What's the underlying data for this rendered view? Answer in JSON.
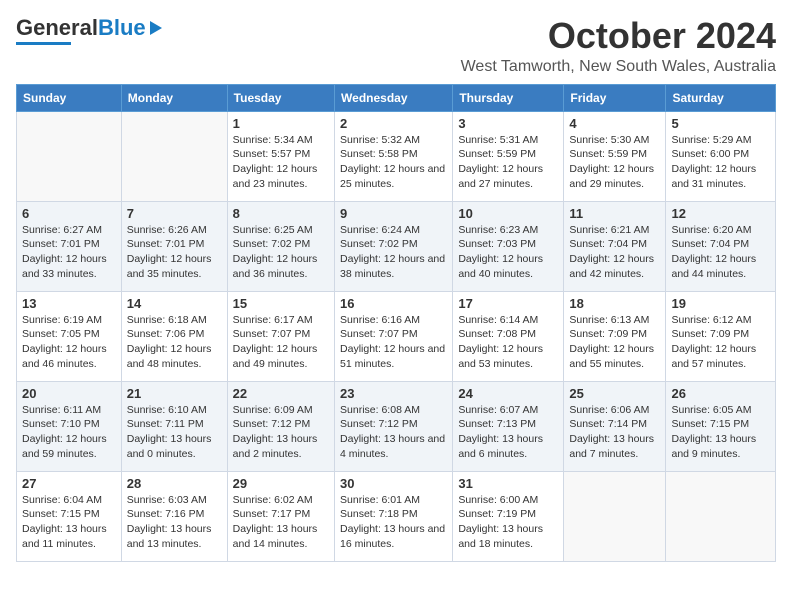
{
  "logo": {
    "line1": "General",
    "line2": "Blue"
  },
  "title": "October 2024",
  "subtitle": "West Tamworth, New South Wales, Australia",
  "days_of_week": [
    "Sunday",
    "Monday",
    "Tuesday",
    "Wednesday",
    "Thursday",
    "Friday",
    "Saturday"
  ],
  "weeks": [
    [
      {
        "day": "",
        "content": ""
      },
      {
        "day": "",
        "content": ""
      },
      {
        "day": "1",
        "content": "Sunrise: 5:34 AM\nSunset: 5:57 PM\nDaylight: 12 hours and 23 minutes."
      },
      {
        "day": "2",
        "content": "Sunrise: 5:32 AM\nSunset: 5:58 PM\nDaylight: 12 hours and 25 minutes."
      },
      {
        "day": "3",
        "content": "Sunrise: 5:31 AM\nSunset: 5:59 PM\nDaylight: 12 hours and 27 minutes."
      },
      {
        "day": "4",
        "content": "Sunrise: 5:30 AM\nSunset: 5:59 PM\nDaylight: 12 hours and 29 minutes."
      },
      {
        "day": "5",
        "content": "Sunrise: 5:29 AM\nSunset: 6:00 PM\nDaylight: 12 hours and 31 minutes."
      }
    ],
    [
      {
        "day": "6",
        "content": "Sunrise: 6:27 AM\nSunset: 7:01 PM\nDaylight: 12 hours and 33 minutes."
      },
      {
        "day": "7",
        "content": "Sunrise: 6:26 AM\nSunset: 7:01 PM\nDaylight: 12 hours and 35 minutes."
      },
      {
        "day": "8",
        "content": "Sunrise: 6:25 AM\nSunset: 7:02 PM\nDaylight: 12 hours and 36 minutes."
      },
      {
        "day": "9",
        "content": "Sunrise: 6:24 AM\nSunset: 7:02 PM\nDaylight: 12 hours and 38 minutes."
      },
      {
        "day": "10",
        "content": "Sunrise: 6:23 AM\nSunset: 7:03 PM\nDaylight: 12 hours and 40 minutes."
      },
      {
        "day": "11",
        "content": "Sunrise: 6:21 AM\nSunset: 7:04 PM\nDaylight: 12 hours and 42 minutes."
      },
      {
        "day": "12",
        "content": "Sunrise: 6:20 AM\nSunset: 7:04 PM\nDaylight: 12 hours and 44 minutes."
      }
    ],
    [
      {
        "day": "13",
        "content": "Sunrise: 6:19 AM\nSunset: 7:05 PM\nDaylight: 12 hours and 46 minutes."
      },
      {
        "day": "14",
        "content": "Sunrise: 6:18 AM\nSunset: 7:06 PM\nDaylight: 12 hours and 48 minutes."
      },
      {
        "day": "15",
        "content": "Sunrise: 6:17 AM\nSunset: 7:07 PM\nDaylight: 12 hours and 49 minutes."
      },
      {
        "day": "16",
        "content": "Sunrise: 6:16 AM\nSunset: 7:07 PM\nDaylight: 12 hours and 51 minutes."
      },
      {
        "day": "17",
        "content": "Sunrise: 6:14 AM\nSunset: 7:08 PM\nDaylight: 12 hours and 53 minutes."
      },
      {
        "day": "18",
        "content": "Sunrise: 6:13 AM\nSunset: 7:09 PM\nDaylight: 12 hours and 55 minutes."
      },
      {
        "day": "19",
        "content": "Sunrise: 6:12 AM\nSunset: 7:09 PM\nDaylight: 12 hours and 57 minutes."
      }
    ],
    [
      {
        "day": "20",
        "content": "Sunrise: 6:11 AM\nSunset: 7:10 PM\nDaylight: 12 hours and 59 minutes."
      },
      {
        "day": "21",
        "content": "Sunrise: 6:10 AM\nSunset: 7:11 PM\nDaylight: 13 hours and 0 minutes."
      },
      {
        "day": "22",
        "content": "Sunrise: 6:09 AM\nSunset: 7:12 PM\nDaylight: 13 hours and 2 minutes."
      },
      {
        "day": "23",
        "content": "Sunrise: 6:08 AM\nSunset: 7:12 PM\nDaylight: 13 hours and 4 minutes."
      },
      {
        "day": "24",
        "content": "Sunrise: 6:07 AM\nSunset: 7:13 PM\nDaylight: 13 hours and 6 minutes."
      },
      {
        "day": "25",
        "content": "Sunrise: 6:06 AM\nSunset: 7:14 PM\nDaylight: 13 hours and 7 minutes."
      },
      {
        "day": "26",
        "content": "Sunrise: 6:05 AM\nSunset: 7:15 PM\nDaylight: 13 hours and 9 minutes."
      }
    ],
    [
      {
        "day": "27",
        "content": "Sunrise: 6:04 AM\nSunset: 7:15 PM\nDaylight: 13 hours and 11 minutes."
      },
      {
        "day": "28",
        "content": "Sunrise: 6:03 AM\nSunset: 7:16 PM\nDaylight: 13 hours and 13 minutes."
      },
      {
        "day": "29",
        "content": "Sunrise: 6:02 AM\nSunset: 7:17 PM\nDaylight: 13 hours and 14 minutes."
      },
      {
        "day": "30",
        "content": "Sunrise: 6:01 AM\nSunset: 7:18 PM\nDaylight: 13 hours and 16 minutes."
      },
      {
        "day": "31",
        "content": "Sunrise: 6:00 AM\nSunset: 7:19 PM\nDaylight: 13 hours and 18 minutes."
      },
      {
        "day": "",
        "content": ""
      },
      {
        "day": "",
        "content": ""
      }
    ]
  ]
}
